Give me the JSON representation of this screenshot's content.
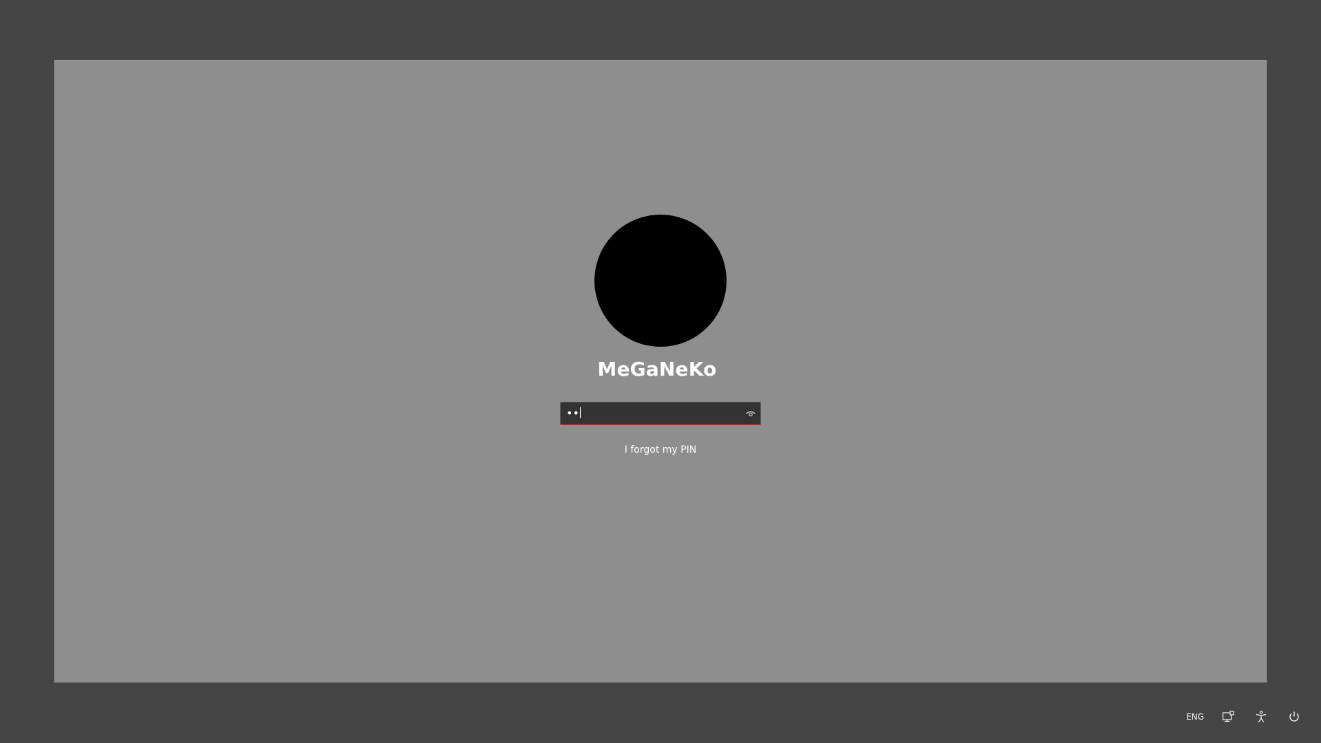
{
  "user": {
    "name": "MeGaNeKo",
    "avatar_color": "#000000"
  },
  "pin_field": {
    "value": "••",
    "reveal_icon": "eye-icon",
    "underline_color": "#c81e1e"
  },
  "links": {
    "forgot_pin": "I forgot my PIN"
  },
  "tray": {
    "language": "ENG",
    "network_icon": "network-icon",
    "accessibility_icon": "accessibility-icon",
    "power_icon": "power-icon"
  },
  "colors": {
    "background": "#454545",
    "panel": "#8e8e8e",
    "field_bg": "#333333"
  }
}
